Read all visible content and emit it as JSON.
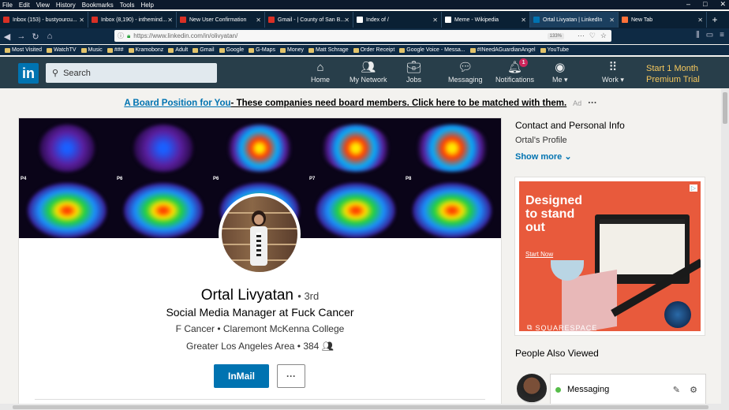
{
  "menu": [
    "File",
    "Edit",
    "View",
    "History",
    "Bookmarks",
    "Tools",
    "Help"
  ],
  "browser_tabs": [
    {
      "label": "Inbox (153) - bustyourcu...",
      "color": "#d93025"
    },
    {
      "label": "Inbox (8,190) - inthemind...",
      "color": "#d93025"
    },
    {
      "label": "New User Confirmation",
      "color": "#d93025"
    },
    {
      "label": "Gmail - | County of San B...",
      "color": "#d93025"
    },
    {
      "label": "Index of /",
      "color": "#ffffff"
    },
    {
      "label": "Meme - Wikipedia",
      "color": "#ffffff"
    },
    {
      "label": "Ortal Livyatan | LinkedIn",
      "color": "#0073b1"
    },
    {
      "label": "New Tab",
      "color": "#ff7139"
    }
  ],
  "address": {
    "url": "https://www.linkedin.com/in/olivyatan/",
    "zoom": "133%"
  },
  "bookmarks": [
    "Most Visited",
    "WatchTV",
    "Music",
    "###",
    "Kramobonz",
    "Adult",
    "Gmail",
    "Google",
    "G-Maps",
    "Money",
    "Matt Schrage",
    "Order Receipt",
    "Google Voice - Messa...",
    "#INeedAGuardianAngel",
    "YouTube"
  ],
  "li_header": {
    "search_placeholder": "Search",
    "nav": [
      {
        "label": "Home",
        "icon": "home-icon"
      },
      {
        "label": "My Network",
        "icon": "network-icon"
      },
      {
        "label": "Jobs",
        "icon": "briefcase-icon"
      },
      {
        "label": "Messaging",
        "icon": "messaging-icon"
      },
      {
        "label": "Notifications",
        "icon": "bell-icon",
        "badge": "1"
      },
      {
        "label": "Me ▾",
        "icon": "avatar-icon"
      },
      {
        "label": "Work ▾",
        "icon": "grid-icon"
      }
    ],
    "premium_line1": "Start 1 Month",
    "premium_line2": "Premium Trial"
  },
  "ad_banner": {
    "link": "A Board Position for You",
    "text": " - These companies need board members. Click here to be matched with them.",
    "tag": "Ad",
    "more": "···"
  },
  "profile": {
    "scan_labels": [
      "P4",
      "P6",
      "P6",
      "P7",
      "P8"
    ],
    "name": "Ortal Livyatan",
    "degree": "• 3rd",
    "headline": "Social Media Manager at Fuck Cancer",
    "subline": "F Cancer  •  Claremont McKenna College",
    "location": "Greater Los Angeles Area  •  384",
    "inmail": "InMail",
    "more": "···"
  },
  "sidebar": {
    "contact_title": "Contact and Personal Info",
    "contact_sub": "Ortal's Profile",
    "show_more": "Show more ⌄",
    "ad_headline": "Designed to stand out",
    "ad_cta": "Start Now",
    "ad_brand": "SQUARESPACE",
    "people_title": "People Also Viewed",
    "messaging": "Messaging"
  }
}
